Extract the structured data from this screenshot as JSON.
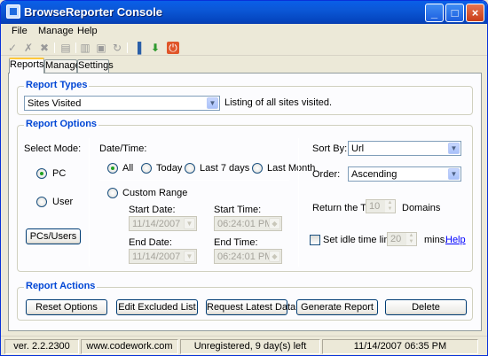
{
  "window": {
    "title": "BrowseReporter Console"
  },
  "menu": [
    "File",
    "Manage",
    "Help"
  ],
  "tabs": [
    "Reports",
    "Manage",
    "Settings"
  ],
  "report_types": {
    "title": "Report Types",
    "selected": "Sites Visited",
    "description": "Listing of all sites visited."
  },
  "report_options": {
    "title": "Report Options",
    "select_mode_label": "Select Mode:",
    "pc_label": "PC",
    "user_label": "User",
    "pcs_users_button": "PCs/Users",
    "datetime_label": "Date/Time:",
    "range_all": "All",
    "range_today": "Today",
    "range_last7": "Last 7 days",
    "range_lastmonth": "Last Month",
    "custom_range": "Custom Range",
    "start_date_label": "Start Date:",
    "start_date": "11/14/2007",
    "start_time_label": "Start Time:",
    "start_time": "06:24:01 PM",
    "end_date_label": "End Date:",
    "end_date": "11/14/2007",
    "end_time_label": "End Time:",
    "end_time": "06:24:01 PM",
    "sort_by_label": "Sort By:",
    "sort_by": "Url",
    "order_label": "Order:",
    "order": "Ascending",
    "return_top_label": "Return the Top",
    "return_top_value": "10",
    "domains_label": "Domains",
    "idle_label": "Set idle time limit to",
    "idle_value": "20",
    "mins_label": "mins.",
    "help_link": "Help"
  },
  "report_actions": {
    "title": "Report Actions",
    "reset": "Reset Options",
    "edit_excluded": "Edit Excluded List",
    "request_latest": "Request Latest Data",
    "generate": "Generate Report",
    "delete": "Delete"
  },
  "status": {
    "version": "ver. 2.2.2300",
    "website": "www.codework.com",
    "registration": "Unregistered, 9 day(s) left",
    "datetime": "11/14/2007 06:35 PM"
  }
}
